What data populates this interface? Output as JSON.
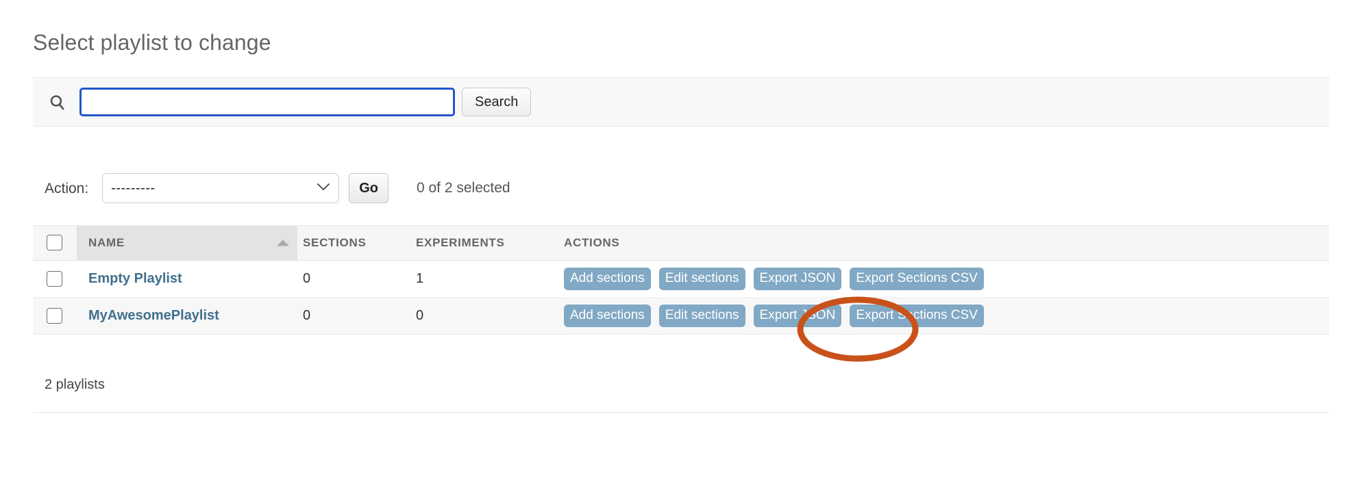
{
  "page": {
    "title": "Select playlist to change"
  },
  "search": {
    "icon": "search-icon",
    "value": "",
    "placeholder": "",
    "button_label": "Search"
  },
  "action_bar": {
    "label": "Action:",
    "selected_option": "---------",
    "options": [
      "---------"
    ],
    "go_label": "Go",
    "selection_status": "0 of 2 selected"
  },
  "table": {
    "columns": [
      "NAME",
      "SECTIONS",
      "EXPERIMENTS",
      "ACTIONS"
    ],
    "sorted_column": "NAME",
    "sort_direction": "asc",
    "rows": [
      {
        "name": "Empty Playlist",
        "sections": "0",
        "experiments": "1",
        "actions": [
          "Add sections",
          "Edit sections",
          "Export JSON",
          "Export Sections CSV"
        ]
      },
      {
        "name": "MyAwesomePlaylist",
        "sections": "0",
        "experiments": "0",
        "actions": [
          "Add sections",
          "Edit sections",
          "Export JSON",
          "Export Sections CSV"
        ]
      }
    ]
  },
  "footer": {
    "result_count": "2 playlists"
  },
  "annotation": {
    "shape": "ellipse",
    "color": "#c9521a",
    "targets": "Edit sections (row 2)"
  },
  "colors": {
    "pill_background": "#81a8c4",
    "link": "#41708c",
    "focus_border": "#2255cc",
    "annotation": "#c9521a",
    "header_background": "#f6f6f6",
    "sorted_header_background": "#e3e3e3"
  }
}
